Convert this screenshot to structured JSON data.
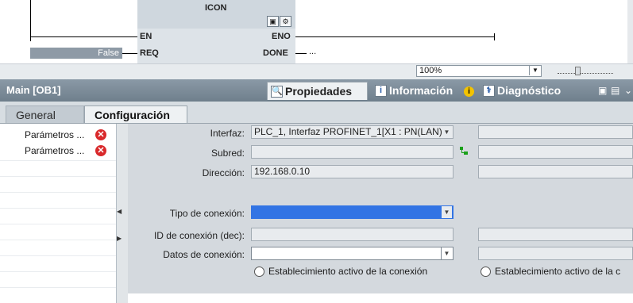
{
  "ladder": {
    "block_title": "ICON",
    "pin_en": "EN",
    "pin_req": "REQ",
    "pin_eno": "ENO",
    "pin_done": "DONE",
    "req_value": "False",
    "done_value": "..."
  },
  "zoom": {
    "value": "100%"
  },
  "inspector": {
    "title": "Main [OB1]",
    "tabs": [
      {
        "label": "Propiedades",
        "icon": "properties-icon",
        "active": true
      },
      {
        "label": "Información",
        "icon": "info-icon",
        "active": false
      },
      {
        "label": "Diagnóstico",
        "icon": "diagnostics-icon",
        "active": false
      }
    ],
    "info_badge": "i"
  },
  "subtabs": [
    {
      "label": "General",
      "active": false
    },
    {
      "label": "Configuración",
      "active": true
    }
  ],
  "nav": {
    "items": [
      {
        "label": "Parámetros ...",
        "status": "error"
      },
      {
        "label": "Parámetros ...",
        "status": "error"
      }
    ]
  },
  "form": {
    "interfaz_label": "Interfaz:",
    "interfaz_value": "PLC_1, Interfaz PROFINET_1[X1 : PN(LAN)]",
    "subred_label": "Subred:",
    "direccion_label": "Dirección:",
    "direccion_value": "192.168.0.10",
    "tipo_label": "Tipo de conexión:",
    "id_label": "ID de conexión (dec):",
    "datos_label": "Datos de conexión:",
    "radio_left_label": "Establecimiento activo de la conexión",
    "radio_right_label": "Establecimiento activo de la c"
  },
  "colors": {
    "header": "#7d8c99",
    "selection": "#3274e4",
    "error": "#d9292b"
  }
}
